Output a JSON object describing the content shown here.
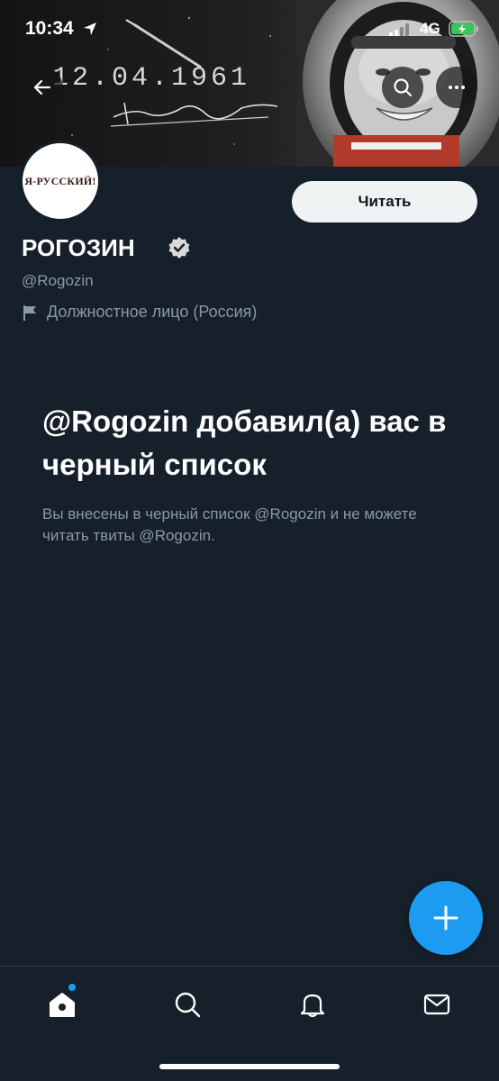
{
  "status_bar": {
    "time": "10:34",
    "network": "4G"
  },
  "banner": {
    "date_text": "12.04.1961"
  },
  "header": {
    "back_icon": "arrow-left-icon",
    "search_icon": "search-icon",
    "more_icon": "more-horizontal-icon"
  },
  "profile": {
    "avatar_text": "Я-РУССКИЙ!",
    "follow_label": "Читать",
    "name": "РОГОЗИН",
    "handle": "@Rogozin",
    "label": "Должностное лицо (Россия)"
  },
  "blocked": {
    "title": "@Rogozin добавил(а) вас в черный список",
    "description": "Вы внесены в черный список @Rogozin и не можете читать твиты @Rogozin."
  },
  "tab_bar": {
    "items": [
      {
        "icon": "home-icon",
        "active": true,
        "has_badge": true
      },
      {
        "icon": "search-icon",
        "active": false
      },
      {
        "icon": "notifications-icon",
        "active": false
      },
      {
        "icon": "messages-icon",
        "active": false
      }
    ]
  },
  "colors": {
    "background": "#15202b",
    "accent": "#1d9bf0",
    "secondary_text": "#8b98a5",
    "follow_button_bg": "#eff3f4"
  }
}
